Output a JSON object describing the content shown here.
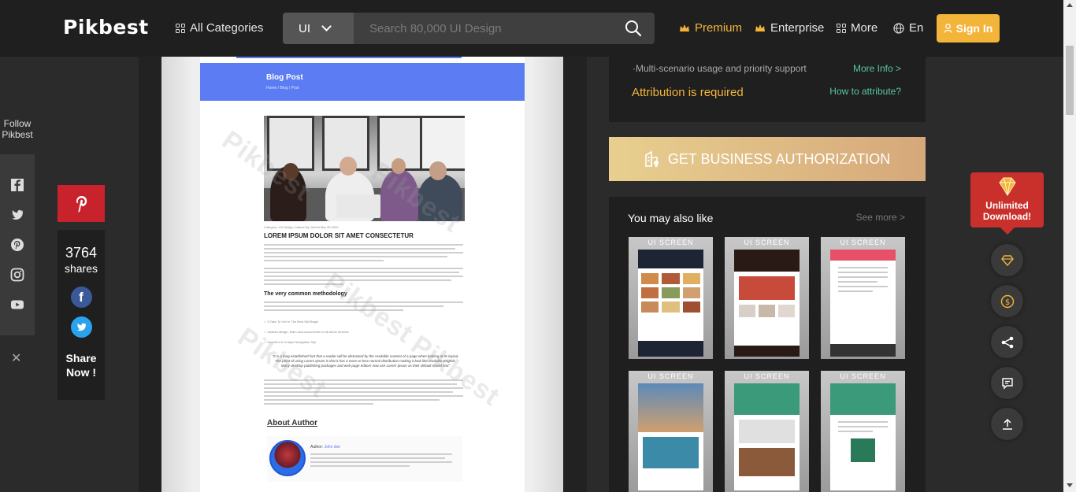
{
  "header": {
    "logo": "Pikbest",
    "all_categories": "All Categories",
    "search_type": "UI",
    "search_placeholder": "Search 80,000 UI Design",
    "premium": "Premium",
    "enterprise": "Enterprise",
    "more": "More",
    "language": "En",
    "sign_in": "Sign In"
  },
  "follow": {
    "label_1": "Follow",
    "label_2": "Pikbest"
  },
  "share": {
    "count": "3764",
    "label": "shares",
    "share_now_1": "Share",
    "share_now_2": "Now !"
  },
  "preview": {
    "hero_title": "Blog Post",
    "breadcrumb": "Home / Blog / Post",
    "meta": "Category: UX Design, Nature        By: Admin        Mar 25,2020",
    "article_title": "LOREM IPSUM DOLOR SIT AMET CONSECTETUR",
    "subheading": "The very common methodology",
    "checklist": [
      "It Taks To Get In The Best Will Begin",
      "Instead design, learn announcements for all alone devices",
      "Excellent & Unique Navigation Styl"
    ],
    "quote": "\"It is a long established fact that a reader will be distracted by the readable content of a page when looking at its layout. The point of using Lorem Ipsum is that it has a more-or-less normal distribution making it look like readable English. Many desktop publishing packages and web page editors now use Lorem Ipsum as their default model text\"",
    "about_author": "About Author",
    "author_label": "Author:",
    "author_name": "John doe",
    "watermark": "Pikbest"
  },
  "info": {
    "usage": "·Multi-scenario usage and priority support",
    "more_info": "More Info >",
    "attribution": "Attribution is required",
    "how_to": "How to attribute?"
  },
  "business_button": "GET BUSINESS AUTHORIZATION",
  "also_like": {
    "title": "You may also like",
    "see_more": "See more >",
    "tag": "UI SCREEN"
  },
  "vip": {
    "line_1": "Unlimited",
    "line_2": "Download!"
  },
  "colors": {
    "accent": "#f3b43a",
    "link": "#58c6a3",
    "pinterest": "#c8232c",
    "blue_hero": "#5b7cf2"
  }
}
